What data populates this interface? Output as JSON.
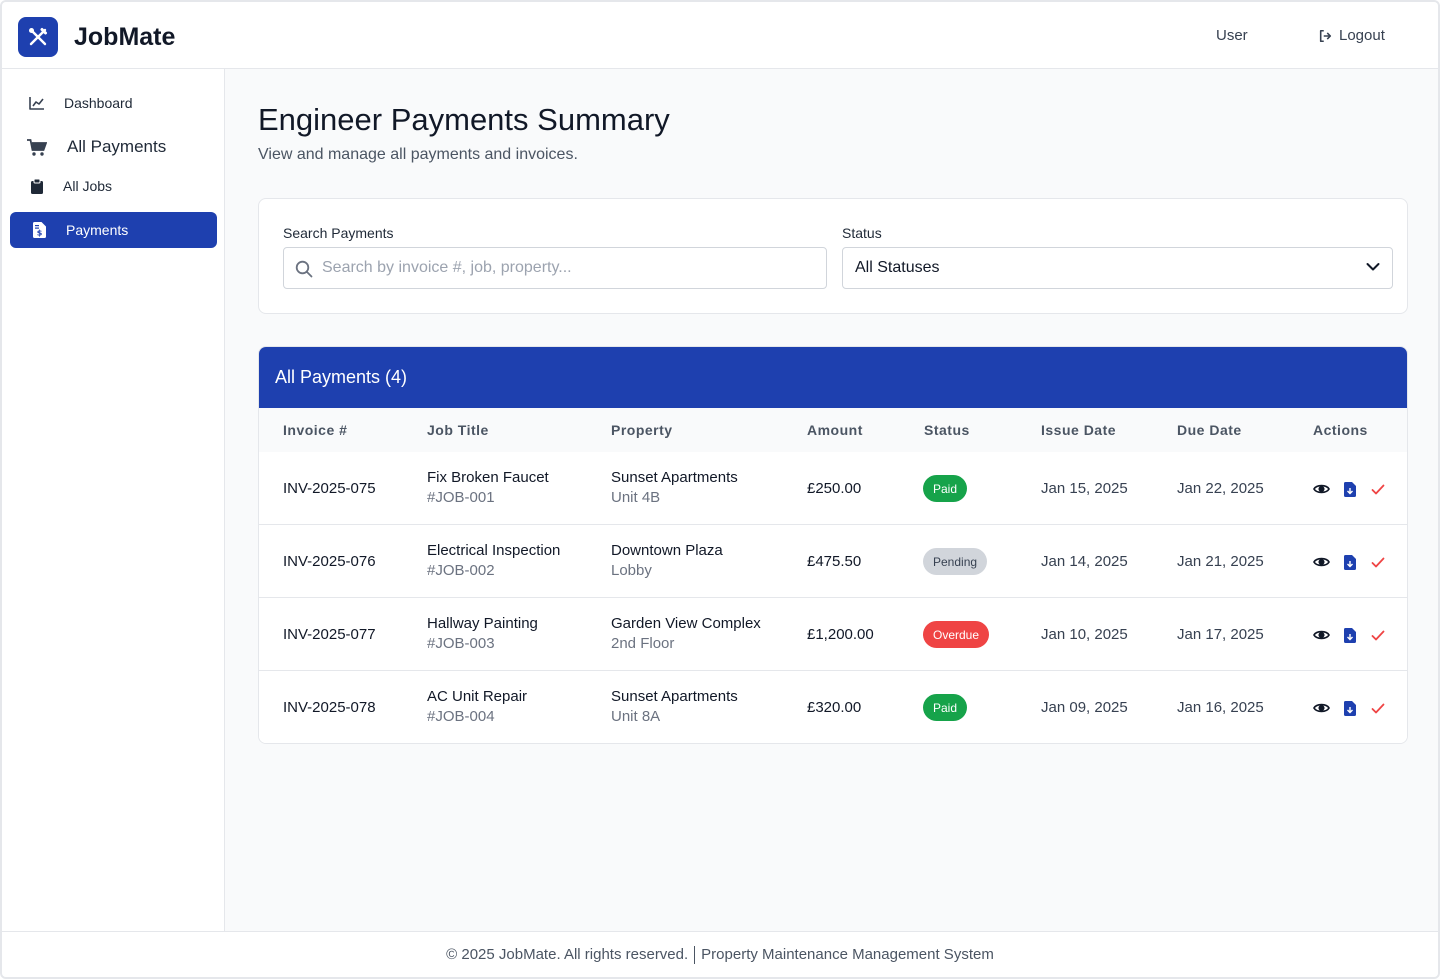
{
  "app": {
    "brand": "JobMate"
  },
  "header": {
    "user_label": "User",
    "logout_label": "Logout"
  },
  "sidebar": {
    "items": [
      {
        "label": "Dashboard",
        "icon": "chart-line-icon"
      },
      {
        "label": "All Payments",
        "icon": "cart-icon"
      },
      {
        "label": "All Jobs",
        "icon": "clipboard-icon"
      },
      {
        "label": "Payments",
        "icon": "invoice-dollar-icon",
        "active": true
      }
    ]
  },
  "main": {
    "title": "Engineer Payments Summary",
    "subtitle": "View and manage all payments and invoices."
  },
  "filters": {
    "search_label": "Search Payments",
    "search_placeholder": "Search by invoice #, job, property...",
    "search_value": "",
    "status_label": "Status",
    "status_value": "All Statuses"
  },
  "table": {
    "title": "All Payments (4)",
    "columns": [
      "Invoice #",
      "Job Title",
      "Property",
      "Amount",
      "Status",
      "Issue Date",
      "Due Date",
      "Actions"
    ],
    "rows": [
      {
        "invoice": "INV-2025-075",
        "job_title": "Fix Broken Faucet",
        "job_id": "#JOB-001",
        "property": "Sunset Apartments",
        "unit": "Unit 4B",
        "amount": "£250.00",
        "status": "Paid",
        "issue_date": "Jan 15, 2025",
        "due_date": "Jan 22, 2025"
      },
      {
        "invoice": "INV-2025-076",
        "job_title": "Electrical Inspection",
        "job_id": "#JOB-002",
        "property": "Downtown Plaza",
        "unit": "Lobby",
        "amount": "£475.50",
        "status": "Pending",
        "issue_date": "Jan 14, 2025",
        "due_date": "Jan 21, 2025"
      },
      {
        "invoice": "INV-2025-077",
        "job_title": "Hallway Painting",
        "job_id": "#JOB-003",
        "property": "Garden View Complex",
        "unit": "2nd Floor",
        "amount": "£1,200.00",
        "status": "Overdue",
        "issue_date": "Jan 10, 2025",
        "due_date": "Jan 17, 2025"
      },
      {
        "invoice": "INV-2025-078",
        "job_title": "AC Unit Repair",
        "job_id": "#JOB-004",
        "property": "Sunset Apartments",
        "unit": "Unit 8A",
        "amount": "£320.00",
        "status": "Paid",
        "issue_date": "Jan 09, 2025",
        "due_date": "Jan 16, 2025"
      }
    ]
  },
  "footer": {
    "copyright": "© 2025 JobMate. All rights reserved.",
    "system": "Property Maintenance Management System"
  },
  "colors": {
    "primary": "#1e40af",
    "paid": "#16a34a",
    "pending": "#d1d5db",
    "overdue": "#ef4444"
  }
}
